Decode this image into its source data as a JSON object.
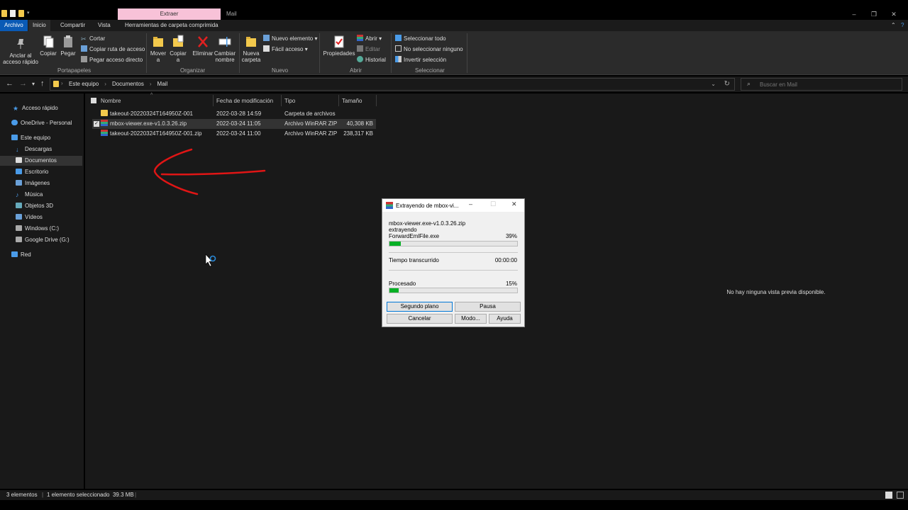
{
  "titlebar": {
    "context_tab": "Extraer",
    "window_title": "Mail"
  },
  "tabs": {
    "archivo": "Archivo",
    "inicio": "Inicio",
    "compartir": "Compartir",
    "vista": "Vista",
    "herramientas": "Herramientas de carpeta comprimida"
  },
  "ribbon": {
    "portapapeles": {
      "label": "Portapapeles",
      "anclar": "Anclar al acceso rápido",
      "copiar": "Copiar",
      "pegar": "Pegar",
      "cortar": "Cortar",
      "copiar_ruta": "Copiar ruta de acceso",
      "pegar_acceso": "Pegar acceso directo"
    },
    "organizar": {
      "label": "Organizar",
      "mover": "Mover a",
      "copiar": "Copiar a",
      "eliminar": "Eliminar",
      "cambiar": "Cambiar nombre"
    },
    "nuevo": {
      "label": "Nuevo",
      "nueva_carpeta": "Nueva carpeta",
      "nuevo_elemento": "Nuevo elemento",
      "facil_acceso": "Fácil acceso"
    },
    "abrir": {
      "label": "Abrir",
      "propiedades": "Propiedades",
      "abrir": "Abrir",
      "editar": "Editar",
      "historial": "Historial"
    },
    "seleccionar": {
      "label": "Seleccionar",
      "todo": "Seleccionar todo",
      "ninguno": "No seleccionar ninguno",
      "invertir": "Invertir selección"
    }
  },
  "address": {
    "crumbs": [
      "Este equipo",
      "Documentos",
      "Mail"
    ],
    "search_placeholder": "Buscar en Mail"
  },
  "nav": {
    "items": [
      "Acceso rápido",
      "OneDrive - Personal",
      "Este equipo",
      "Descargas",
      "Documentos",
      "Escritorio",
      "Imágenes",
      "Música",
      "Objetos 3D",
      "Vídeos",
      "Windows (C:)",
      "Google Drive (G:)",
      "Red"
    ]
  },
  "columns": {
    "nombre": "Nombre",
    "fecha": "Fecha de modificación",
    "tipo": "Tipo",
    "tamano": "Tamaño"
  },
  "files": [
    {
      "name": "takeout-20220324T164950Z-001",
      "date": "2022-03-28 14:59",
      "type": "Carpeta de archivos",
      "size": ""
    },
    {
      "name": "mbox-viewer.exe-v1.0.3.26.zip",
      "date": "2022-03-24 11:05",
      "type": "Archivo WinRAR ZIP",
      "size": "40,308 KB"
    },
    {
      "name": "takeout-20220324T164950Z-001.zip",
      "date": "2022-03-24 11:00",
      "type": "Archivo WinRAR ZIP",
      "size": "238,317 KB"
    }
  ],
  "preview": {
    "message": "No hay ninguna vista previa disponible."
  },
  "status": {
    "count": "3 elementos",
    "selected": "1 elemento seleccionado  39.3 MB"
  },
  "dialog": {
    "title": "Extrayendo de mbox-vi...",
    "archive": "mbox-viewer.exe-v1.0.3.26.zip",
    "action": "extrayendo",
    "file": "ForwardEmlFile.exe",
    "file_percent": "39%",
    "file_progress": 0.09,
    "elapsed_label": "Tiempo transcurrido",
    "elapsed_value": "00:00:00",
    "processed_label": "Procesado",
    "processed_percent": "15%",
    "processed_progress": 0.07,
    "btn_background": "Segundo plano",
    "btn_pause": "Pausa",
    "btn_cancel": "Cancelar",
    "btn_mode": "Modo...",
    "btn_help": "Ayuda"
  }
}
